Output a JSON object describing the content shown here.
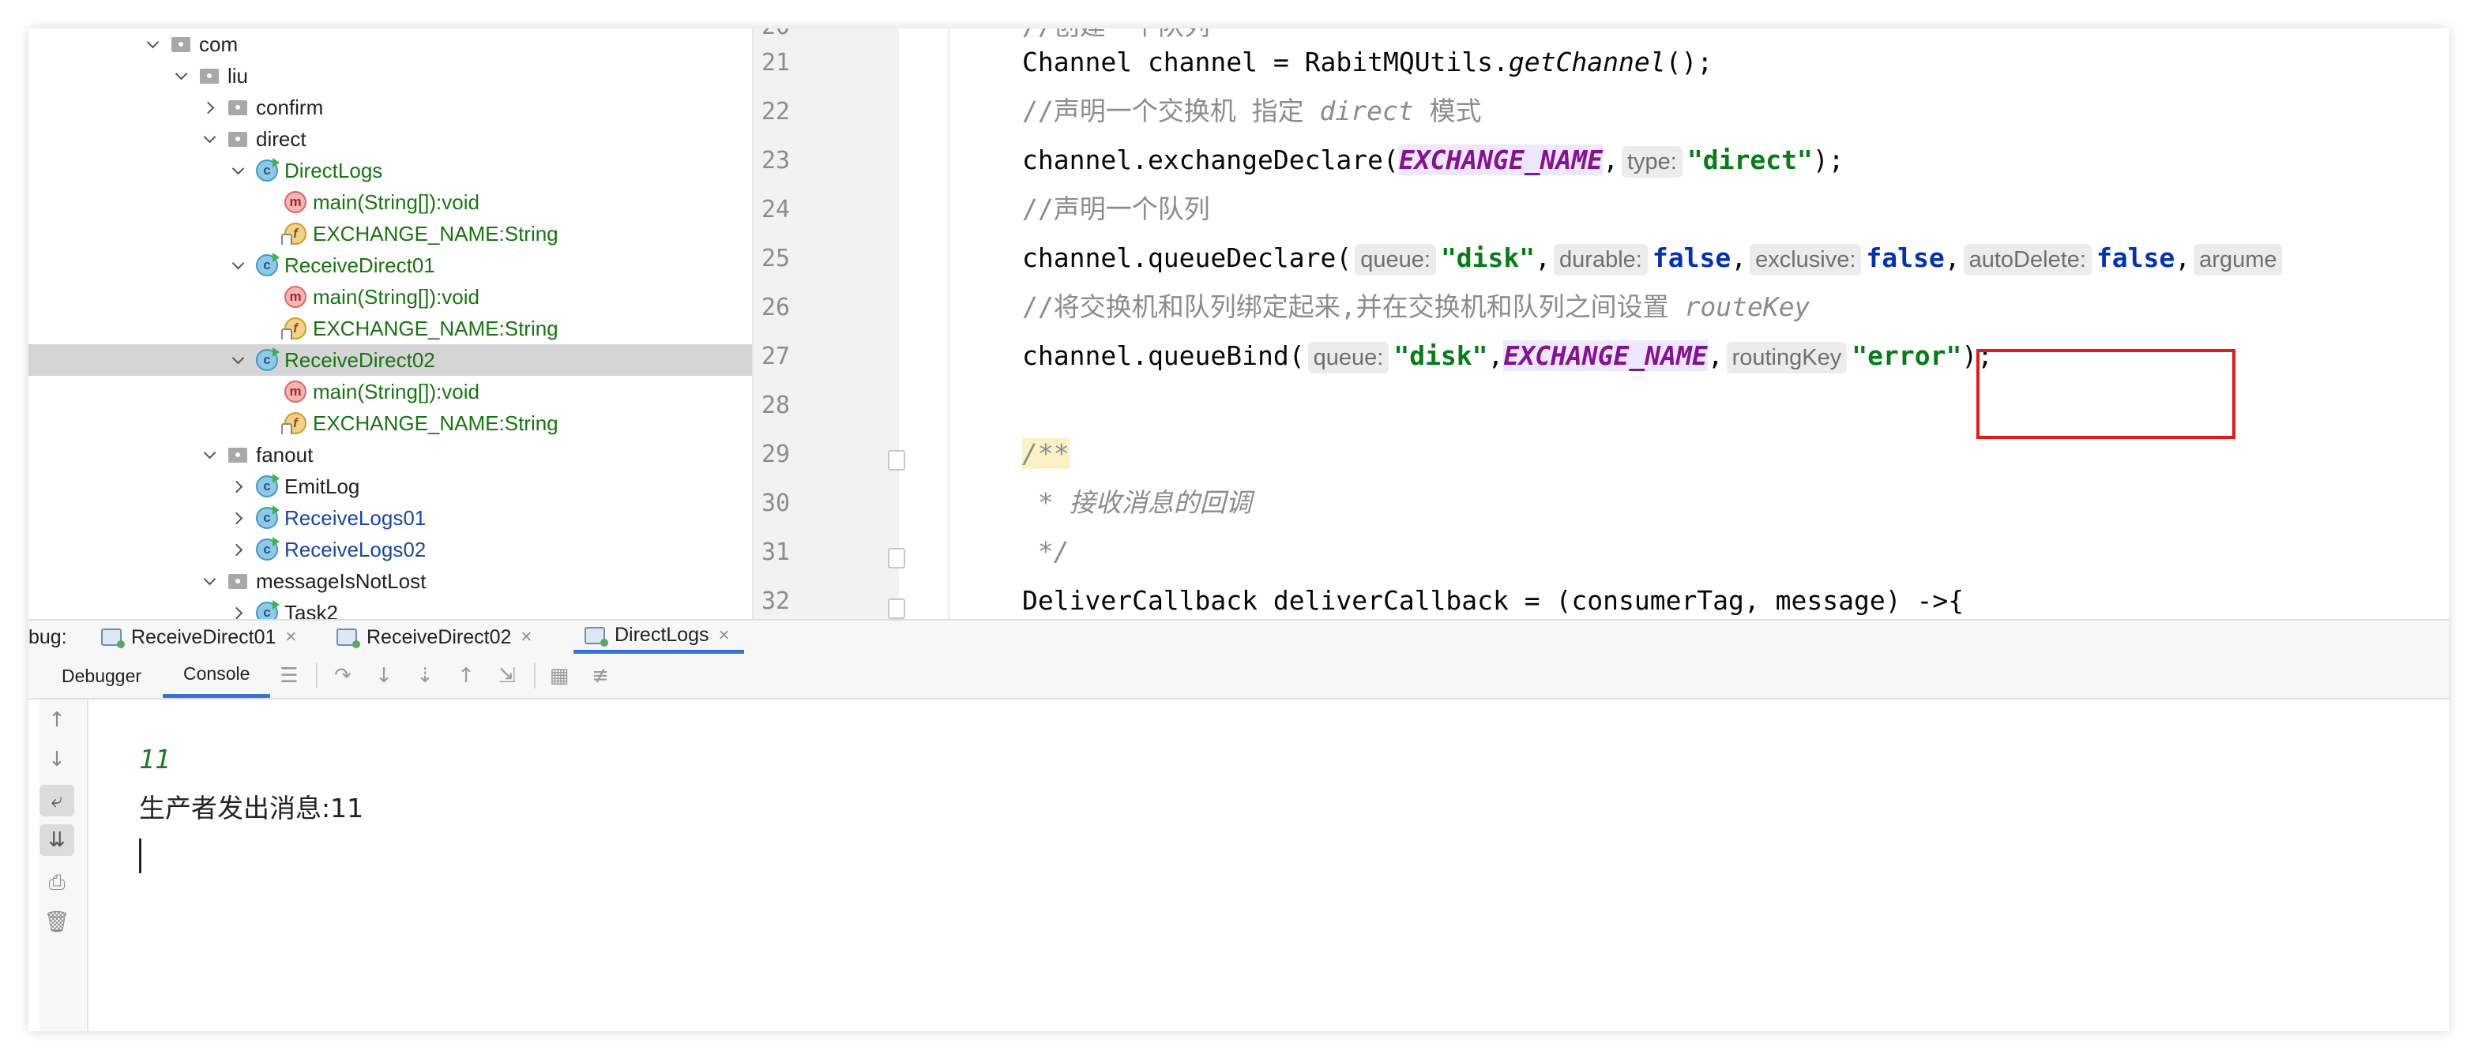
{
  "tree": {
    "items": [
      {
        "label": "com",
        "kind": "package",
        "depth": 0,
        "state": "open",
        "color": "dark"
      },
      {
        "label": "liu",
        "kind": "package",
        "depth": 1,
        "state": "open",
        "color": "dark"
      },
      {
        "label": "confirm",
        "kind": "package",
        "depth": 2,
        "state": "closed",
        "color": "dark"
      },
      {
        "label": "direct",
        "kind": "package",
        "depth": 2,
        "state": "open",
        "color": "dark"
      },
      {
        "label": "DirectLogs",
        "kind": "class",
        "depth": 3,
        "state": "open",
        "color": "green"
      },
      {
        "label": "main(String[]):void",
        "kind": "method",
        "depth": 4,
        "state": "none",
        "color": "green"
      },
      {
        "label": "EXCHANGE_NAME:String",
        "kind": "field",
        "depth": 4,
        "state": "none",
        "color": "green"
      },
      {
        "label": "ReceiveDirect01",
        "kind": "class",
        "depth": 3,
        "state": "open",
        "color": "green"
      },
      {
        "label": "main(String[]):void",
        "kind": "method",
        "depth": 4,
        "state": "none",
        "color": "green"
      },
      {
        "label": "EXCHANGE_NAME:String",
        "kind": "field",
        "depth": 4,
        "state": "none",
        "color": "green"
      },
      {
        "label": "ReceiveDirect02",
        "kind": "class",
        "depth": 3,
        "state": "open",
        "color": "green",
        "selected": true
      },
      {
        "label": "main(String[]):void",
        "kind": "method",
        "depth": 4,
        "state": "none",
        "color": "green"
      },
      {
        "label": "EXCHANGE_NAME:String",
        "kind": "field",
        "depth": 4,
        "state": "none",
        "color": "green"
      },
      {
        "label": "fanout",
        "kind": "package",
        "depth": 2,
        "state": "open",
        "color": "dark"
      },
      {
        "label": "EmitLog",
        "kind": "class",
        "depth": 3,
        "state": "closed",
        "color": "dark"
      },
      {
        "label": "ReceiveLogs01",
        "kind": "class",
        "depth": 3,
        "state": "closed",
        "color": "blue"
      },
      {
        "label": "ReceiveLogs02",
        "kind": "class",
        "depth": 3,
        "state": "closed",
        "color": "blue"
      },
      {
        "label": "messageIsNotLost",
        "kind": "package",
        "depth": 2,
        "state": "open",
        "color": "dark"
      },
      {
        "label": "Task2",
        "kind": "class",
        "depth": 3,
        "state": "closed",
        "color": "dark"
      }
    ]
  },
  "editor": {
    "line_numbers": [
      "21",
      "22",
      "23",
      "24",
      "25",
      "26",
      "27",
      "28",
      "29",
      "30",
      "31",
      "32"
    ],
    "code": {
      "l21_pre": "Channel channel = RabitMQUtils.",
      "l21_method": "getChannel",
      "l21_post": "();",
      "l22_cmt1": "//声明一个交换机 指定 ",
      "l22_cmt_it": "direct",
      "l22_cmt2": " 模式",
      "l23_pre": "channel.exchangeDeclare(",
      "l23_const": "EXCHANGE_NAME",
      "l23_comma": ",",
      "l23_hint": "type:",
      "l23_str": "\"direct\"",
      "l23_post": ");",
      "l24_cmt": "//声明一个队列",
      "l25_pre": "channel.queueDeclare(",
      "l25_hint1": "queue:",
      "l25_str": "\"disk\"",
      "l25_comma1": ",",
      "l25_hint2": "durable:",
      "l25_kw1": "false",
      "l25_comma2": ",",
      "l25_hint3": "exclusive:",
      "l25_kw2": "false",
      "l25_comma3": ",",
      "l25_hint4": "autoDelete:",
      "l25_kw3": "false",
      "l25_comma4": ",",
      "l25_hint5": "argume",
      "l26_cmt1": "//将交换机和队列绑定起来,并在交换机和队列之间设置 ",
      "l26_cmt_it": "routeKey",
      "l27_pre": "channel.queueBind(",
      "l27_hint1": "queue:",
      "l27_str1": "\"disk\"",
      "l27_comma1": ",",
      "l27_const": "EXCHANGE_NAME",
      "l27_comma2": ",",
      "l27_hint2": "routingKey",
      "l27_str2": "\"error\"",
      "l27_post": ");",
      "l29_doc": "/**",
      "l30_doc": " * 接收消息的回调",
      "l31_doc": " */",
      "l32_code": "DeliverCallback deliverCallback = (consumerTag, message) ->{"
    }
  },
  "debug": {
    "label": "bug:",
    "tabs": [
      {
        "label": "ReceiveDirect01",
        "close": "×"
      },
      {
        "label": "ReceiveDirect02",
        "close": "×"
      },
      {
        "label": "DirectLogs",
        "close": "×"
      }
    ],
    "active_tab": "DirectLogs"
  },
  "toolbar": {
    "debugger_label": "Debugger",
    "console_label": "Console",
    "active": "Console"
  },
  "console": {
    "input_line": "11",
    "output_line": "生产者发出消息:11"
  },
  "colors": {
    "accent": "#3874d6",
    "highlight_box": "#e11b1b",
    "string": "#067d17",
    "keyword": "#0033b3",
    "constant": "#871094",
    "selection": "#d5d5d5"
  }
}
